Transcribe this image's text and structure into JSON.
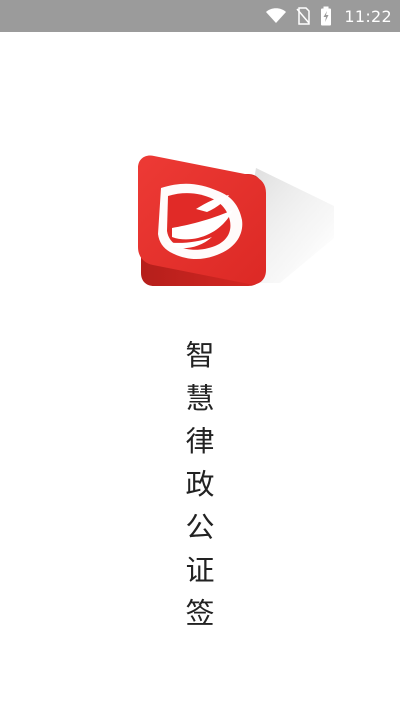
{
  "status_bar": {
    "time": "11:22",
    "icons": [
      "wifi-icon",
      "no-sim-icon",
      "battery-charging-icon"
    ],
    "background": "#9b9b9b"
  },
  "logo": {
    "icon": "shield-logo-icon",
    "primary_color": "#e12a27",
    "secondary_color": "#ffffff"
  },
  "title": {
    "chars": [
      "智",
      "慧",
      "律",
      "政",
      "公",
      "证",
      "签"
    ]
  }
}
